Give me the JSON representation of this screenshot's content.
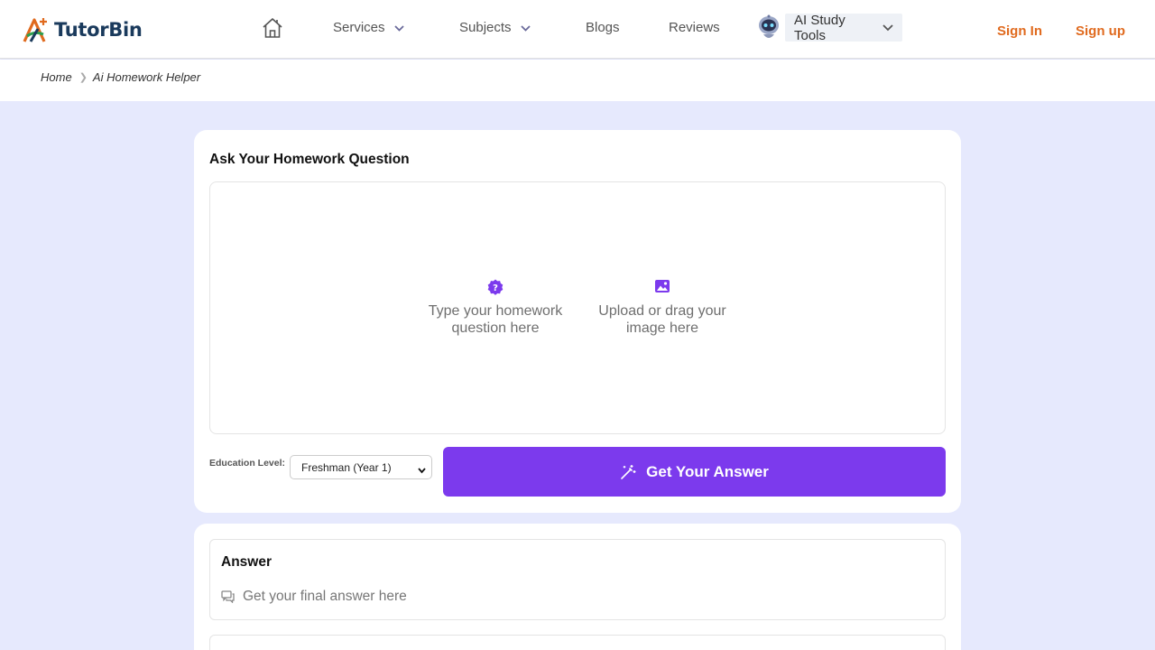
{
  "brand": {
    "name": "TutorBin",
    "logo_icon": "tutorbin-logo-icon",
    "accent_orange": "#e06a1e",
    "logo_green": "#2e9e4f"
  },
  "nav": {
    "home_icon": "home-icon",
    "services_label": "Services",
    "subjects_label": "Subjects",
    "blogs_label": "Blogs",
    "reviews_label": "Reviews",
    "ai_tools_label": "AI Study Tools",
    "ai_tools_icon": "robot-icon"
  },
  "auth": {
    "sign_in": "Sign In",
    "sign_up": "Sign up"
  },
  "breadcrumb": {
    "home": "Home",
    "current": "Ai Homework Helper"
  },
  "question": {
    "title": "Ask Your Homework Question",
    "type_option": "Type your homework question here",
    "upload_option": "Upload or drag your image here",
    "education_label": "Education Level:",
    "education_value": "Freshman (Year 1)",
    "submit_label": "Get Your Answer",
    "accent_purple": "#7c3aed"
  },
  "answer": {
    "title": "Answer",
    "hint": "Get your final answer here"
  }
}
